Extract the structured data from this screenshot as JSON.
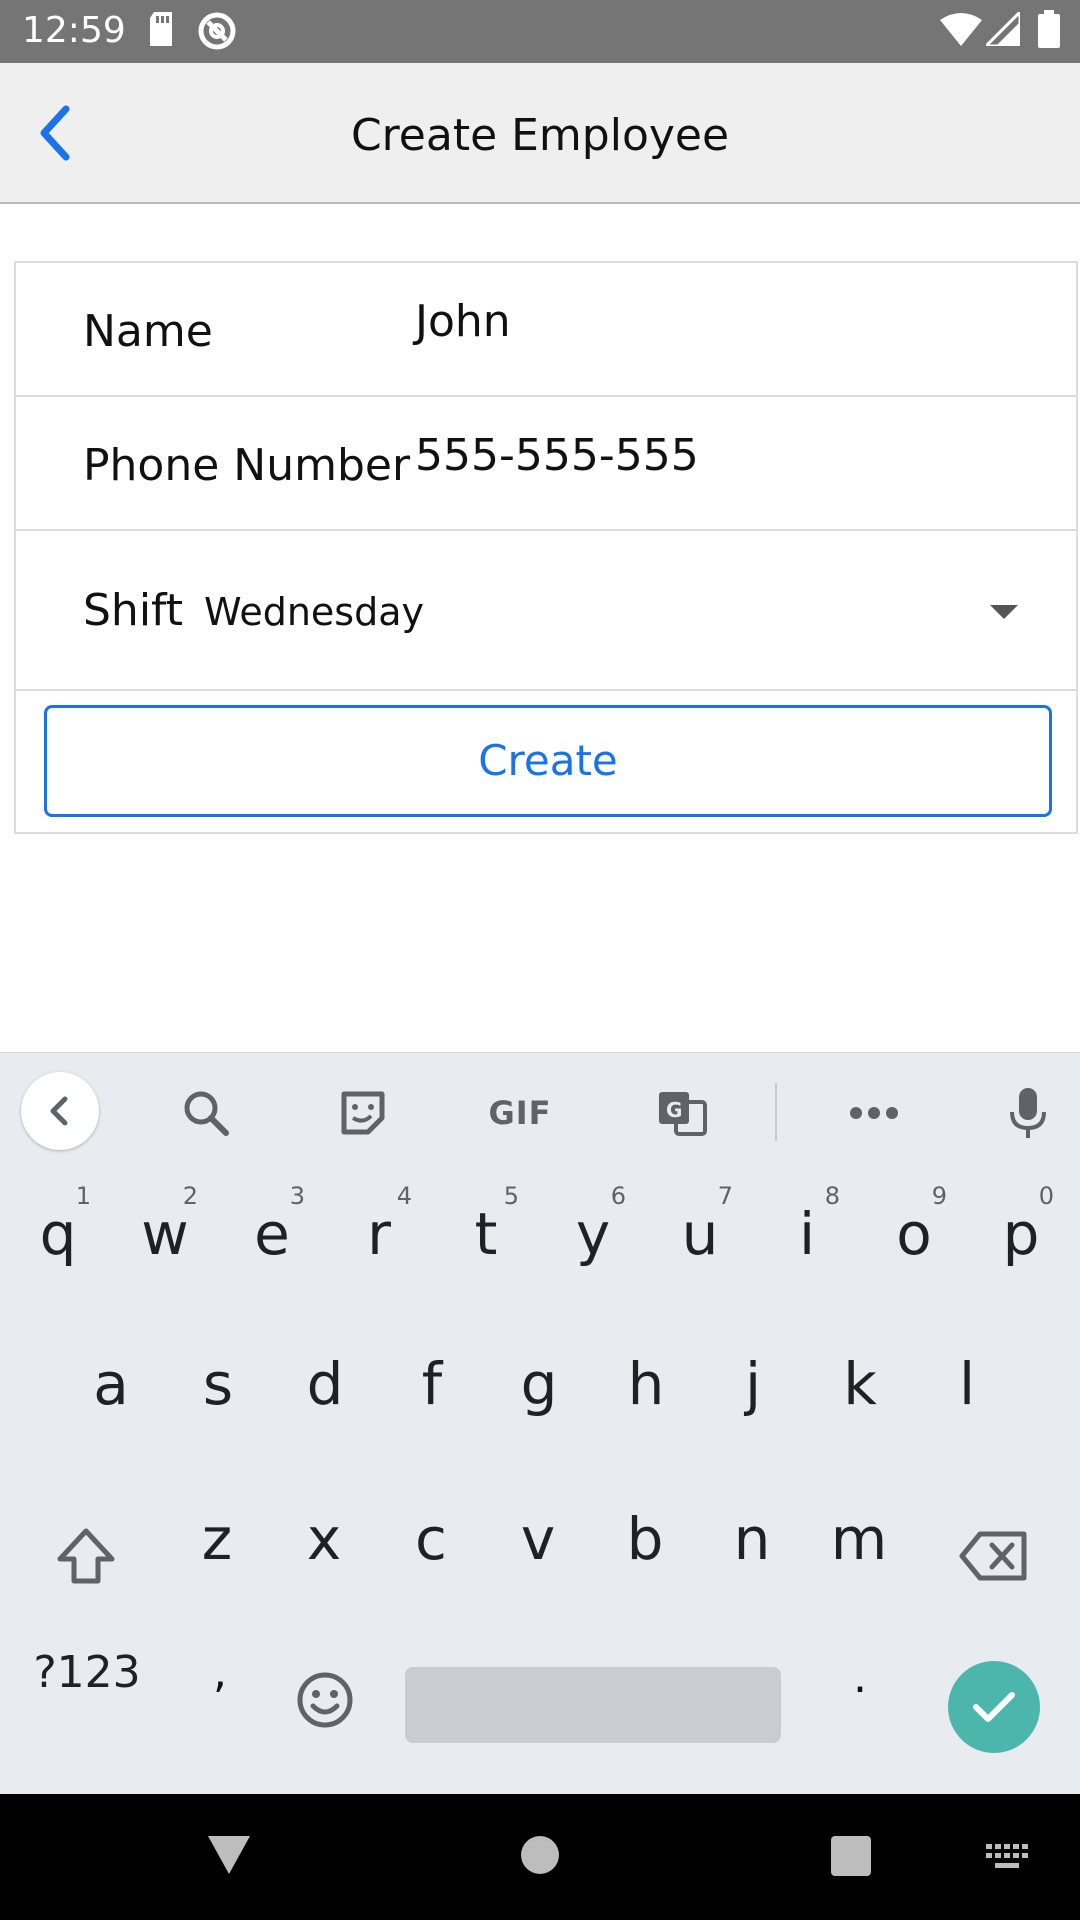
{
  "status_bar": {
    "time": "12:59",
    "icons": [
      "sd-card-icon",
      "no-disturb-icon",
      "wifi-icon",
      "cell-signal-icon",
      "battery-icon"
    ]
  },
  "app_bar": {
    "title": "Create Employee",
    "back_icon": "chevron-left-icon",
    "accent_color": "#1a73e8"
  },
  "form": {
    "name_label": "Name",
    "name_value": "John",
    "phone_label": "Phone Number",
    "phone_value": "555-555-555",
    "shift_label": "Shift",
    "shift_value": "Wednesday",
    "shift_icon": "dropdown-caret-icon",
    "create_label": "Create"
  },
  "keyboard": {
    "toolbar_icons": [
      "chevron-left-icon",
      "search-icon",
      "sticker-icon",
      "gif-icon",
      "translate-icon",
      "more-icon",
      "mic-icon"
    ],
    "gif_label": "GIF",
    "row1": [
      {
        "ch": "q",
        "hint": "1"
      },
      {
        "ch": "w",
        "hint": "2"
      },
      {
        "ch": "e",
        "hint": "3"
      },
      {
        "ch": "r",
        "hint": "4"
      },
      {
        "ch": "t",
        "hint": "5"
      },
      {
        "ch": "y",
        "hint": "6"
      },
      {
        "ch": "u",
        "hint": "7"
      },
      {
        "ch": "i",
        "hint": "8"
      },
      {
        "ch": "o",
        "hint": "9"
      },
      {
        "ch": "p",
        "hint": "0"
      }
    ],
    "row2": [
      "a",
      "s",
      "d",
      "f",
      "g",
      "h",
      "j",
      "k",
      "l"
    ],
    "row3": [
      "z",
      "x",
      "c",
      "v",
      "b",
      "n",
      "m"
    ],
    "symbols_label": "?123",
    "comma_label": ",",
    "period_label": ".",
    "enter_color": "#4db6ac"
  },
  "nav_bar": {
    "icons": [
      "back-triangle-icon",
      "home-circle-icon",
      "recents-square-icon",
      "keyboard-switch-icon"
    ]
  }
}
